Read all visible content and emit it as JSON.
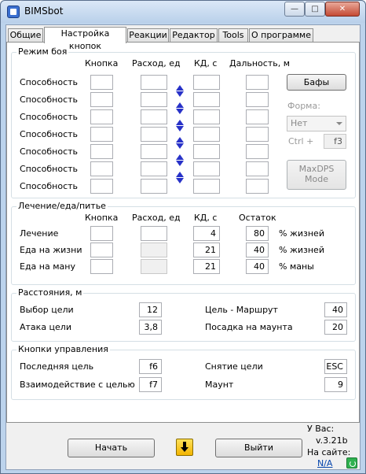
{
  "window": {
    "title": "BIMSbot",
    "close_glyph": "✕",
    "min_glyph": "—",
    "max_glyph": "□"
  },
  "tabs": [
    "Общие",
    "Настройка кнопок",
    "Реакции",
    "Редактор",
    "Tools",
    "О программе"
  ],
  "combat": {
    "title": "Режим боя",
    "headers": {
      "button": "Кнопка",
      "cost": "Расход, ед",
      "cd": "КД, с",
      "range": "Дальность, м"
    },
    "row_label": "Способность",
    "row_count": 7,
    "buffs_label": "Бафы",
    "form_label": "Форма:",
    "form_value": "Нет",
    "ctrl_label": "Ctrl +",
    "ctrl_key": "f3",
    "maxdps_label1": "MaxDPS",
    "maxdps_label2": "Mode"
  },
  "heal": {
    "title": "Лечение/еда/питье",
    "headers": {
      "button": "Кнопка",
      "cost": "Расход, ед",
      "cd": "КД, с",
      "remain": "Остаток"
    },
    "rows": [
      {
        "label": "Лечение",
        "cd": "4",
        "remain": "80",
        "unit": "% жизней"
      },
      {
        "label": "Еда на жизни",
        "cd": "21",
        "remain": "40",
        "unit": "% жизней"
      },
      {
        "label": "Еда на ману",
        "cd": "21",
        "remain": "40",
        "unit": "% маны"
      }
    ]
  },
  "distance": {
    "title": "Расстояния, м",
    "target_select_label": "Выбор цели",
    "target_select_value": "12",
    "attack_label": "Атака цели",
    "attack_value": "3,8",
    "route_label": "Цель - Маршрут",
    "route_value": "40",
    "mount_landing_label": "Посадка на маунта",
    "mount_landing_value": "20"
  },
  "controls": {
    "title": "Кнопки управления",
    "last_target_label": "Последняя цель",
    "last_target_key": "f6",
    "interact_label": "Взаимодействие с целью",
    "interact_key": "f7",
    "clear_target_label": "Снятие цели",
    "clear_target_key": "ESC",
    "mount_label": "Маунт",
    "mount_key": "9"
  },
  "footer": {
    "start_label": "Начать",
    "exit_label": "Выйти",
    "you_have_label": "У Вас:",
    "version": "v.3.21b",
    "on_site_label": "На сайте:",
    "site_version": "N/A"
  }
}
